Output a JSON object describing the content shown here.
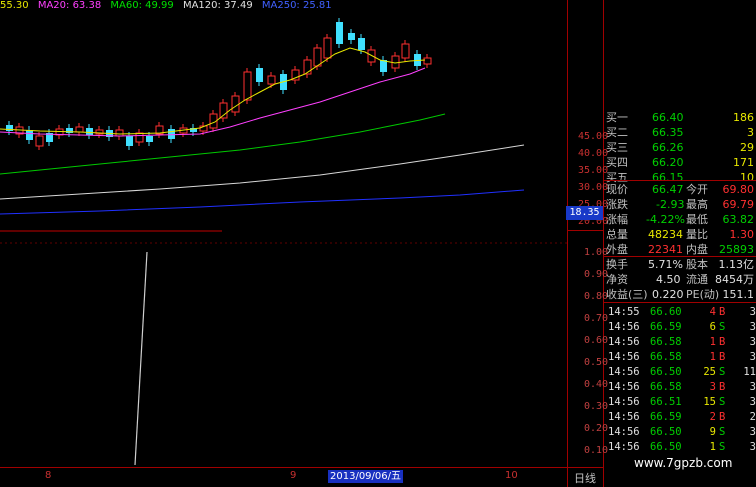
{
  "ma_legend": [
    {
      "label": "55.30",
      "color": "#e8e800"
    },
    {
      "label": "MA20: 63.38",
      "color": "#ff40ff"
    },
    {
      "label": "MA60: 49.99",
      "color": "#00e000"
    },
    {
      "label": "MA120: 37.49",
      "color": "#e0e0e0"
    },
    {
      "label": "MA250: 25.81",
      "color": "#4060ff"
    }
  ],
  "price_axis": [
    "45.00",
    "40.00",
    "35.00",
    "30.00",
    "25.00",
    "20.00"
  ],
  "price_marker": "18.35",
  "lower_axis": [
    "1.00",
    "0.90",
    "0.80",
    "0.70",
    "0.60",
    "0.50",
    "0.40",
    "0.30",
    "0.20",
    "0.10"
  ],
  "x_axis": {
    "labels": [
      "8",
      "9",
      "10"
    ],
    "date": "2013/09/06/五",
    "period": "日线"
  },
  "watermark": "www.7gpzb.com",
  "order_book": [
    {
      "label": "买一",
      "price": "66.40",
      "vol": "186"
    },
    {
      "label": "买二",
      "price": "66.35",
      "vol": "3"
    },
    {
      "label": "买三",
      "price": "66.26",
      "vol": "29"
    },
    {
      "label": "买四",
      "price": "66.20",
      "vol": "171"
    },
    {
      "label": "买五",
      "price": "66.15",
      "vol": "10"
    }
  ],
  "quote": {
    "now_lbl": "现价",
    "now": "66.47",
    "open_lbl": "今开",
    "open": "69.80",
    "chg_lbl": "涨跌",
    "chg": "-2.93",
    "high_lbl": "最高",
    "high": "69.79",
    "pct_lbl": "涨幅",
    "pct": "-4.22%",
    "low_lbl": "最低",
    "low": "63.82",
    "vol_lbl": "总量",
    "vol": "48234",
    "ratio_lbl": "量比",
    "ratio": "1.30",
    "out_lbl": "外盘",
    "out": "22341",
    "in_lbl": "内盘",
    "in": "25893"
  },
  "fundamentals": {
    "turn_lbl": "换手",
    "turn": "5.71%",
    "cap_lbl": "股本",
    "cap": "1.13亿",
    "nav_lbl": "净资",
    "nav": "4.50",
    "float_lbl": "流通",
    "float": "8454万",
    "eps_lbl": "收益(三)",
    "eps": "0.220",
    "pe_lbl": "PE(动)",
    "pe": "151.1"
  },
  "ticks": [
    {
      "time": "14:55",
      "price": "66.60",
      "vol": "4",
      "side": "B",
      "n": "3"
    },
    {
      "time": "14:56",
      "price": "66.59",
      "vol": "6",
      "side": "S",
      "n": "3"
    },
    {
      "time": "14:56",
      "price": "66.58",
      "vol": "1",
      "side": "B",
      "n": "3"
    },
    {
      "time": "14:56",
      "price": "66.58",
      "vol": "1",
      "side": "B",
      "n": "3"
    },
    {
      "time": "14:56",
      "price": "66.50",
      "vol": "25",
      "side": "S",
      "n": "11"
    },
    {
      "time": "14:56",
      "price": "66.58",
      "vol": "3",
      "side": "B",
      "n": "3"
    },
    {
      "time": "14:56",
      "price": "66.51",
      "vol": "15",
      "side": "S",
      "n": "3"
    },
    {
      "time": "14:56",
      "price": "66.59",
      "vol": "2",
      "side": "B",
      "n": "2"
    },
    {
      "time": "14:56",
      "price": "66.50",
      "vol": "9",
      "side": "S",
      "n": "3"
    },
    {
      "time": "14:56",
      "price": "66.50",
      "vol": "1",
      "side": "S",
      "n": "3"
    }
  ]
}
